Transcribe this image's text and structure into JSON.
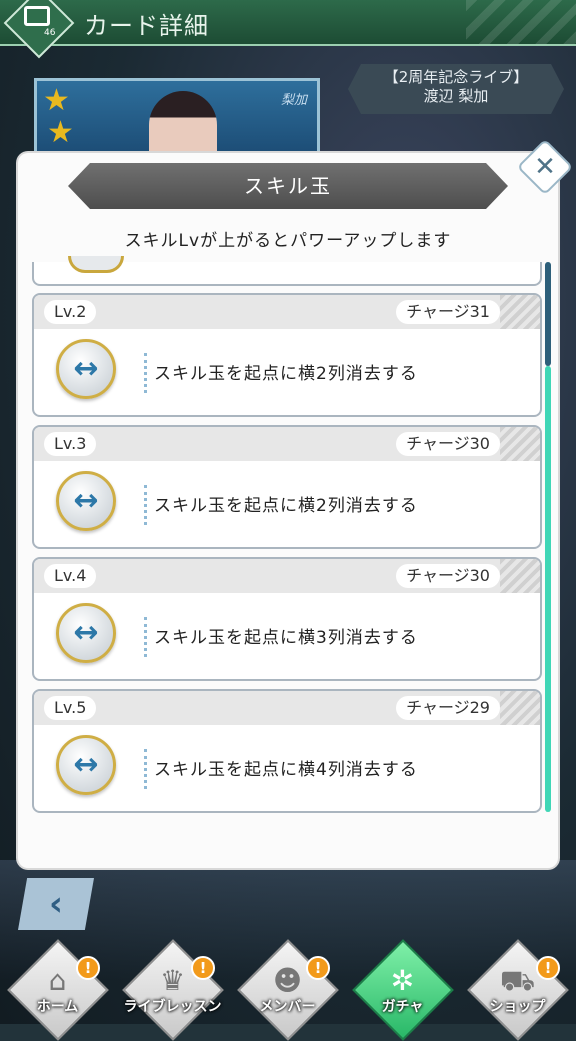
{
  "header": {
    "title": "カード詳細",
    "icon_number": "46"
  },
  "card": {
    "event": "【2周年記念ライブ】",
    "member": "渡辺 梨加",
    "signature": "梨加"
  },
  "modal": {
    "title": "スキル玉",
    "subtitle": "スキルLvが上がるとパワーアップします",
    "levels": [
      {
        "lv": "Lv.2",
        "charge": "チャージ31",
        "desc": "スキル玉を起点に横2列消去する"
      },
      {
        "lv": "Lv.3",
        "charge": "チャージ30",
        "desc": "スキル玉を起点に横2列消去する"
      },
      {
        "lv": "Lv.4",
        "charge": "チャージ30",
        "desc": "スキル玉を起点に横3列消去する"
      },
      {
        "lv": "Lv.5",
        "charge": "チャージ29",
        "desc": "スキル玉を起点に横4列消去する"
      }
    ],
    "skill_icon": "horizontal-arrow-icon"
  },
  "nav": {
    "items": [
      {
        "label": "ホーム",
        "icon": "home-icon",
        "badge": "!"
      },
      {
        "label": "ライブレッスン",
        "icon": "lesson-icon",
        "badge": "!"
      },
      {
        "label": "メンバー",
        "icon": "member-icon",
        "badge": "!"
      },
      {
        "label": "ガチャ",
        "icon": "gacha-icon",
        "badge": ""
      },
      {
        "label": "ショップ",
        "icon": "shop-icon",
        "badge": "!"
      }
    ]
  },
  "colors": {
    "accent": "#3fd6b6",
    "header": "#2d6a4a",
    "badge": "#f29a1b"
  }
}
